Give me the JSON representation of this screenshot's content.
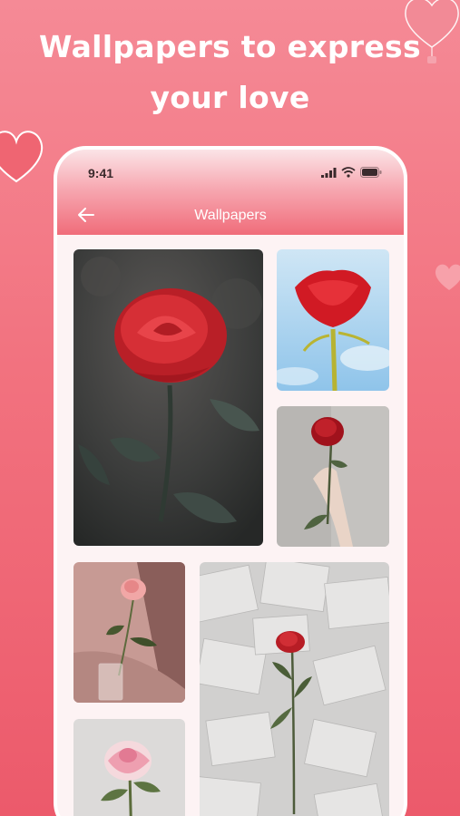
{
  "promo": {
    "headline_line1": "Wallpapers to express",
    "headline_line2": "your love"
  },
  "status_bar": {
    "time": "9:41",
    "icons": [
      "signal-icon",
      "wifi-icon",
      "battery-icon"
    ]
  },
  "app_bar": {
    "title": "Wallpapers",
    "back_icon": "arrow-left-icon"
  },
  "wallpapers": [
    {
      "id": "wallpaper-1",
      "subject": "red rose with water droplets on dark background"
    },
    {
      "id": "wallpaper-2",
      "subject": "red rose against blue sky"
    },
    {
      "id": "wallpaper-3",
      "subject": "hand holding red rose on grey background"
    },
    {
      "id": "wallpaper-4",
      "subject": "pink rose in glass vase"
    },
    {
      "id": "wallpaper-5",
      "subject": "red rose on scattered book pages"
    },
    {
      "id": "wallpaper-6",
      "subject": "pink white rose on light background"
    }
  ],
  "colors": {
    "background": "#f2727f",
    "header_accent": "#f06c7a",
    "text_light": "#ffffff",
    "rose_red": "#d4252e"
  }
}
